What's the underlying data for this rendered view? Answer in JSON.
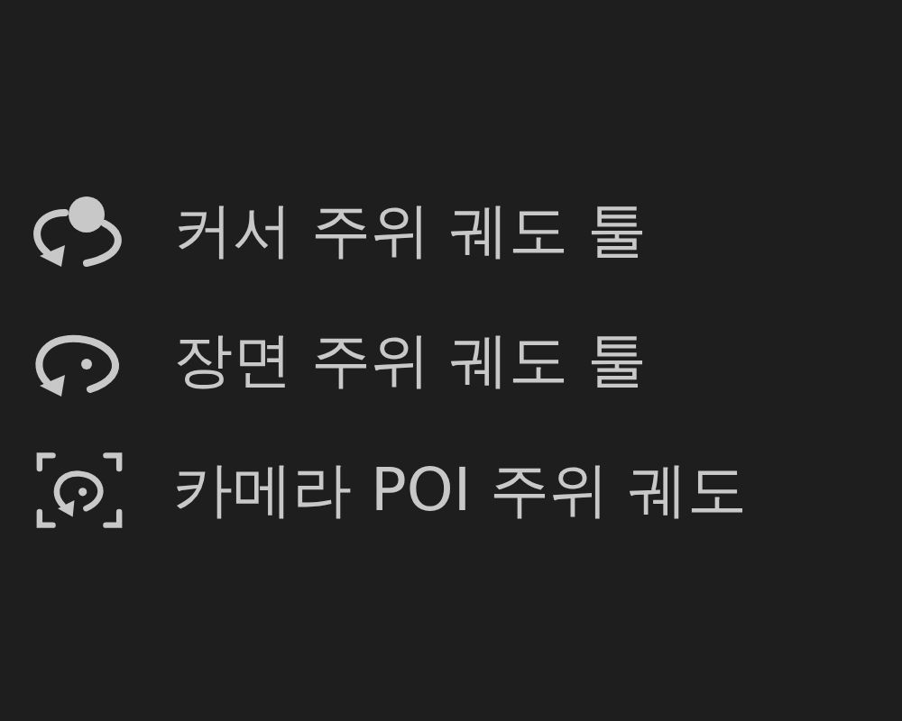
{
  "menu_items": [
    {
      "kind": "cursor",
      "label": "커서 주위 궤도 툴"
    },
    {
      "kind": "scene",
      "label": "장면 주위 궤도 툴"
    },
    {
      "kind": "camera",
      "label": "카메라 POI 주위 궤도"
    }
  ]
}
